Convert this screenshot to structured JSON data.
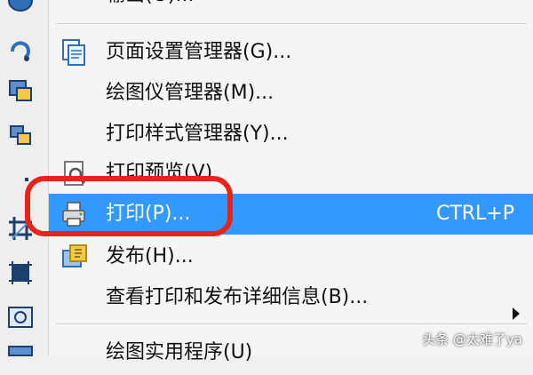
{
  "menu": {
    "items": [
      {
        "label": "页面设置管理器(G)...",
        "shortcut": "",
        "icon": "page-setup-icon"
      },
      {
        "label": "绘图仪管理器(M)...",
        "shortcut": "",
        "icon": ""
      },
      {
        "label": "打印样式管理器(Y)...",
        "shortcut": "",
        "icon": ""
      },
      {
        "label": "打印预览(V)",
        "shortcut": "",
        "icon": "print-preview-icon"
      },
      {
        "label": "打印(P)...",
        "shortcut": "CTRL+P",
        "icon": "printer-icon",
        "highlighted": true
      },
      {
        "label": "发布(H)...",
        "shortcut": "",
        "icon": "publish-icon"
      },
      {
        "label": "查看打印和发布详细信息(B)...",
        "shortcut": "",
        "icon": ""
      },
      {
        "label": "绘图实用程序(U)",
        "shortcut": "",
        "icon": ""
      }
    ],
    "top_partial_label": "输出(O)..."
  },
  "watermark": "头条 @太难了ya",
  "colors": {
    "highlight": "#3399ff",
    "annotation": "#e8231c",
    "menu_bg": "#f5f5f5"
  }
}
